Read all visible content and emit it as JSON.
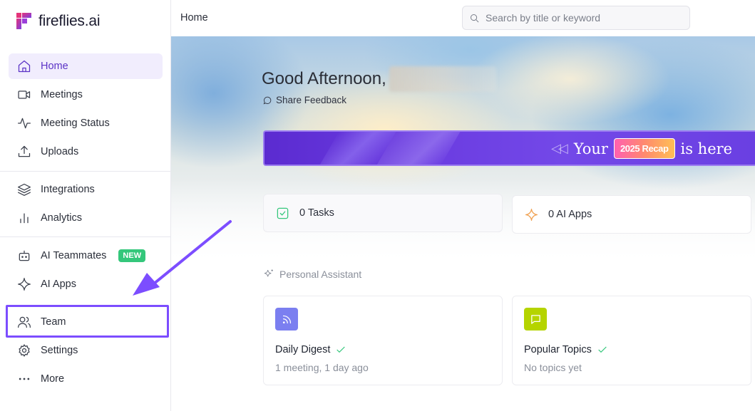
{
  "brand": {
    "name": "fireflies.ai",
    "accent": "#5b33c6"
  },
  "sidebar": {
    "items": [
      {
        "label": "Home",
        "icon": "home-icon",
        "active": true
      },
      {
        "label": "Meetings",
        "icon": "video-icon"
      },
      {
        "label": "Meeting Status",
        "icon": "activity-icon"
      },
      {
        "label": "Uploads",
        "icon": "upload-icon"
      },
      {
        "label": "Integrations",
        "icon": "layers-icon"
      },
      {
        "label": "Analytics",
        "icon": "bar-chart-icon"
      },
      {
        "label": "AI Teammates",
        "icon": "bot-icon",
        "badge": "NEW"
      },
      {
        "label": "AI Apps",
        "icon": "sparkle-icon"
      },
      {
        "label": "Team",
        "icon": "users-icon",
        "highlighted": true
      },
      {
        "label": "Settings",
        "icon": "gear-icon"
      },
      {
        "label": "More",
        "icon": "more-icon"
      }
    ]
  },
  "header": {
    "breadcrumb": "Home",
    "search_placeholder": "Search by title or keyword"
  },
  "main": {
    "greeting": "Good Afternoon,",
    "share_feedback": "Share Feedback",
    "recap": {
      "prefix": "Your",
      "pill": "2025 Recap",
      "suffix": "is here"
    },
    "tasks_label": "0 Tasks",
    "ai_apps_label": "0 AI Apps",
    "personal_assistant_label": "Personal Assistant",
    "cards": [
      {
        "title": "Daily Digest",
        "subtitle": "1 meeting, 1 day ago",
        "icon": "rss-icon",
        "color": "#7b7ff0"
      },
      {
        "title": "Popular Topics",
        "subtitle": "No topics yet",
        "icon": "chat-icon",
        "color": "#b5d400"
      }
    ]
  }
}
